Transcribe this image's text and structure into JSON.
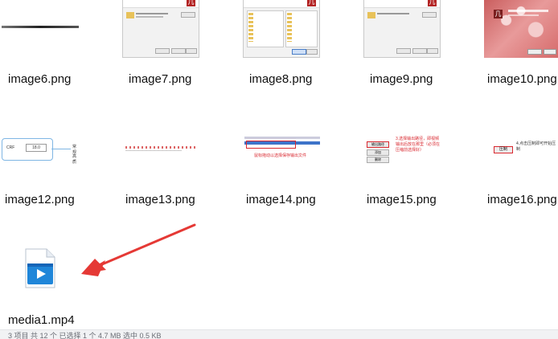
{
  "files": [
    {
      "name": "image6.png"
    },
    {
      "name": "image7.png"
    },
    {
      "name": "image8.png"
    },
    {
      "name": "image9.png"
    },
    {
      "name": "image10.png"
    },
    {
      "name": "image12.png"
    },
    {
      "name": "image13.png"
    },
    {
      "name": "image14.png"
    },
    {
      "name": "image15.png"
    },
    {
      "name": "image16.png"
    },
    {
      "name": "media1.mp4"
    }
  ],
  "thumbs": {
    "image12": {
      "label": "CRF",
      "value": "18.0",
      "side_top": "常规",
      "side_bottom": "高质"
    },
    "image14": {
      "hint": "鼠标拖动以选择保存输出文件"
    },
    "image15": {
      "btn_top": "输出路径",
      "btn_mid": "添加",
      "btn_bottom": "删除",
      "note": "3.选择输出路径，即视频输出后放在那里（必须在压缩前选择好）"
    },
    "image16": {
      "btn": "压制",
      "note": "4.点击压制即可开始压制"
    }
  },
  "status_bar": {
    "text": "3 项目 共 12 个 已选择 1 个 4.7 MB 选中 0.5 KB"
  },
  "colors": {
    "arrow": "#e53935",
    "accent": "#2b6fd6",
    "red_text": "#d9272e"
  }
}
